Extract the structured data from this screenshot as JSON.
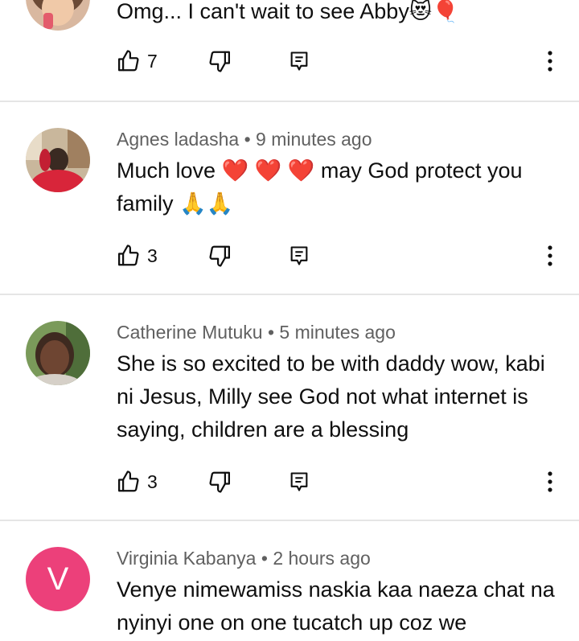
{
  "comments": [
    {
      "author": "",
      "time": "",
      "text": "Omg... I can't wait to see Abby😻🎈",
      "likes": "7"
    },
    {
      "author": "Agnes ladasha",
      "time": "9 minutes ago",
      "text": "Much love ❤️ ❤️ ❤️ may God protect you family 🙏🙏",
      "likes": "3"
    },
    {
      "author": "Catherine Mutuku",
      "time": "5 minutes ago",
      "text": "She is so excited to be with daddy wow, kabi ni Jesus, Milly see God not what internet is saying, children are a blessing",
      "likes": "3"
    },
    {
      "author": "Virginia Kabanya",
      "time": "2 hours ago",
      "avatar_letter": "V",
      "text": "Venye nimewamiss naskia kaa naeza chat na nyinyi one on one tucatch up coz we",
      "likes": ""
    }
  ],
  "separator": "•",
  "colors": {
    "avatar_v": "#ec407a",
    "divider": "#e5e5e5",
    "meta": "#606060"
  }
}
